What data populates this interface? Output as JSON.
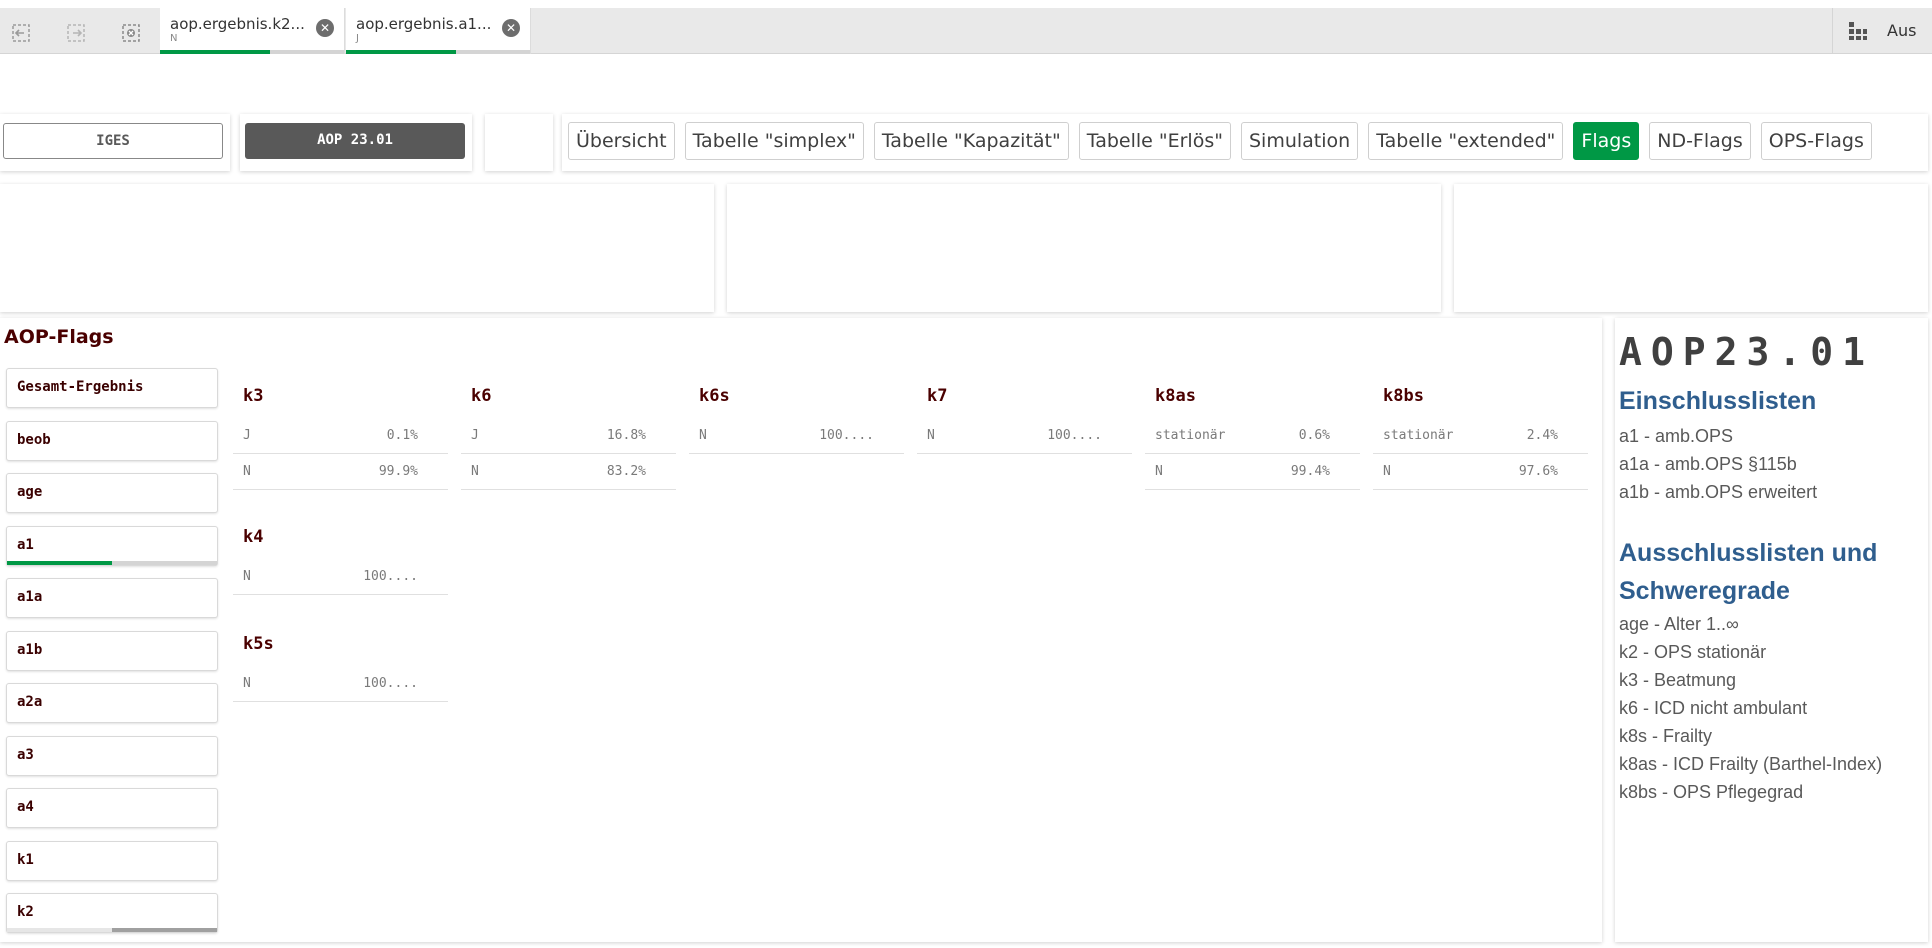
{
  "toolbar": {
    "icons": [
      "back-selection-icon",
      "forward-selection-icon",
      "clear-selections-icon"
    ],
    "selection_tabs": [
      {
        "field": "aop.ergebnis.k2...",
        "value": "N",
        "progress": 0.6
      },
      {
        "field": "aop.ergebnis.a1...",
        "value": "J",
        "progress": 0.6
      }
    ],
    "right_label": "Aus"
  },
  "header": {
    "iges_label": "IGES",
    "version_label": "AOP 23.01",
    "nav": [
      "Übersicht",
      "Tabelle \"simplex\"",
      "Tabelle \"Kapazität\"",
      "Tabelle \"Erlös\"",
      "Simulation",
      "Tabelle \"extended\"",
      "Flags",
      "ND-Flags",
      "OPS-Flags"
    ],
    "active_nav": "Flags"
  },
  "left": {
    "title": "AOP-Flags",
    "items": [
      {
        "label": "Gesamt-Ergebnis"
      },
      {
        "label": "beob"
      },
      {
        "label": "age"
      },
      {
        "label": "a1",
        "progress": 0.5,
        "color": "#009845"
      },
      {
        "label": "a1a"
      },
      {
        "label": "a1b"
      },
      {
        "label": "a2a"
      },
      {
        "label": "a3"
      },
      {
        "label": "a4"
      },
      {
        "label": "k1"
      },
      {
        "label": "k2",
        "progress": 0.5,
        "color": "#a0a0a0"
      }
    ]
  },
  "flags": {
    "k3": {
      "title": "k3",
      "rows": [
        {
          "k": "J",
          "v": "0.1%"
        },
        {
          "k": "N",
          "v": "99.9%"
        }
      ]
    },
    "k6": {
      "title": "k6",
      "rows": [
        {
          "k": "J",
          "v": "16.8%"
        },
        {
          "k": "N",
          "v": "83.2%"
        }
      ]
    },
    "k6s": {
      "title": "k6s",
      "rows": [
        {
          "k": "N",
          "v": "100...."
        }
      ]
    },
    "k7": {
      "title": "k7",
      "rows": [
        {
          "k": "N",
          "v": "100...."
        }
      ]
    },
    "k8as": {
      "title": "k8as",
      "rows": [
        {
          "k": "stationär",
          "v": "0.6%"
        },
        {
          "k": "N",
          "v": "99.4%"
        }
      ]
    },
    "k8bs": {
      "title": "k8bs",
      "rows": [
        {
          "k": "stationär",
          "v": "2.4%"
        },
        {
          "k": "N",
          "v": "97.6%"
        }
      ]
    },
    "k4": {
      "title": "k4",
      "rows": [
        {
          "k": "N",
          "v": "100...."
        }
      ]
    },
    "k5s": {
      "title": "k5s",
      "rows": [
        {
          "k": "N",
          "v": "100...."
        }
      ]
    }
  },
  "info": {
    "title": "AOP23.01",
    "einschluss_heading": "Einschlusslisten",
    "einschluss": [
      "a1 - amb.OPS",
      "a1a - amb.OPS §115b",
      "a1b - amb.OPS erweitert"
    ],
    "ausschluss_heading_1": "Ausschlusslisten und",
    "ausschluss_heading_2": "Schweregrade",
    "ausschluss": [
      "age - Alter 1..∞",
      "k2 - OPS stationär",
      "k3 - Beatmung",
      "k6 - ICD nicht ambulant",
      "k8s - Frailty",
      "k8as - ICD Frailty (Barthel-Index)",
      "k8bs - OPS Pflegegrad"
    ]
  }
}
